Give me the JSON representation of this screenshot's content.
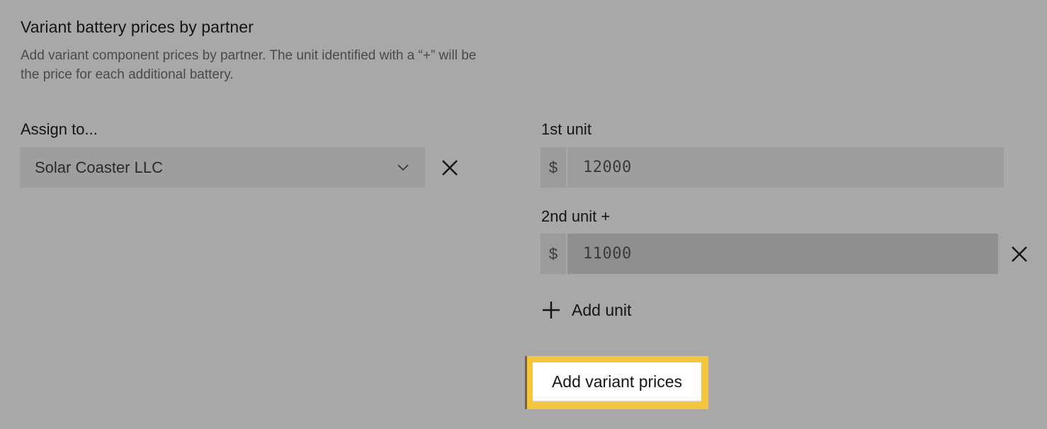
{
  "section": {
    "title": "Variant battery prices by partner",
    "description": "Add variant component prices by partner. The unit identified with a “+” will be the price for each additional battery."
  },
  "assign": {
    "label": "Assign to...",
    "selected_value": "Solar Coaster LLC"
  },
  "units": [
    {
      "label": "1st unit",
      "currency": "$",
      "value": "12000"
    },
    {
      "label": "2nd unit +",
      "currency": "$",
      "value": "11000"
    }
  ],
  "add_unit_label": "Add unit",
  "submit_label": "Add variant prices",
  "colors": {
    "page_bg": "#a8a8a8",
    "field_bg": "#9e9e9e",
    "active_field_bg": "#8f8f8f",
    "focus_accent": "#f4c53d"
  }
}
